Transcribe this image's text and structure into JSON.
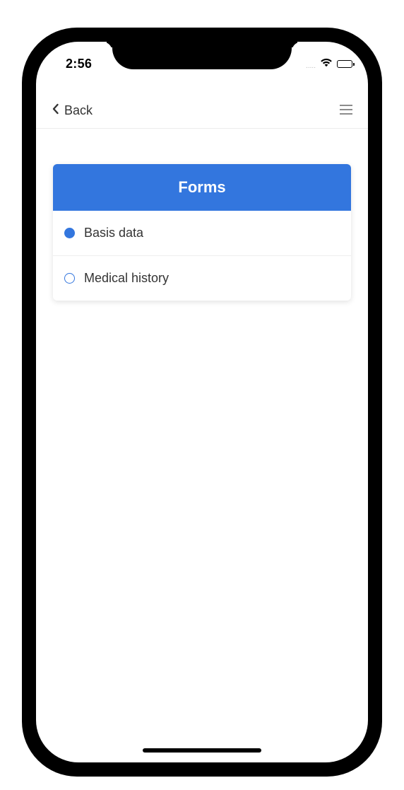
{
  "status_bar": {
    "time": "2:56",
    "signal_dots": "....."
  },
  "navbar": {
    "back_label": "Back"
  },
  "forms_card": {
    "title": "Forms",
    "items": [
      {
        "label": "Basis data",
        "selected": true
      },
      {
        "label": "Medical history",
        "selected": false
      }
    ]
  },
  "colors": {
    "accent": "#3376de",
    "text": "#333333",
    "menu_icon": "#8c8c8c"
  },
  "icons": {
    "back": "chevron-left-icon",
    "menu": "hamburger-menu-icon",
    "wifi": "wifi-icon",
    "battery": "battery-icon"
  }
}
